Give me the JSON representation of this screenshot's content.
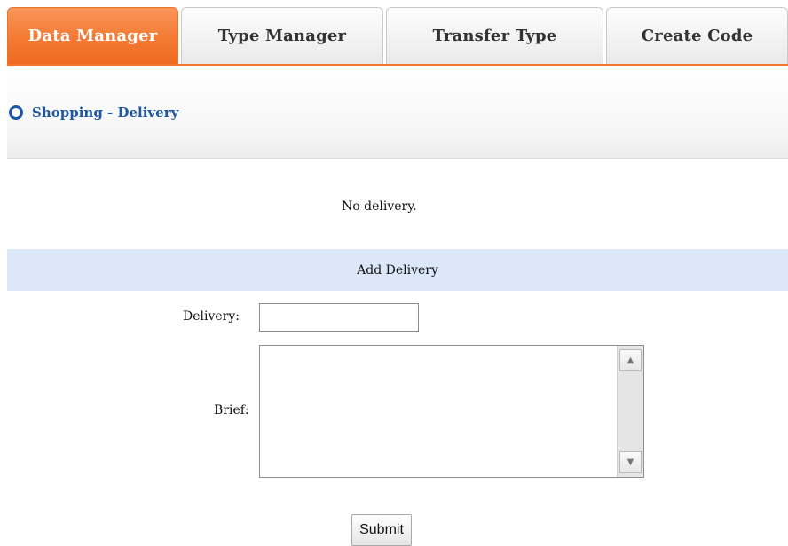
{
  "tabs": [
    {
      "label": "Data Manager",
      "active": true
    },
    {
      "label": "Type Manager",
      "active": false
    },
    {
      "label": "Transfer Type",
      "active": false
    },
    {
      "label": "Create Code",
      "active": false
    }
  ],
  "breadcrumb": {
    "icon": "circle-icon",
    "text": "Shopping - Delivery"
  },
  "message": "No delivery.",
  "form": {
    "header": "Add Delivery",
    "delivery_label": "Delivery:",
    "delivery_value": "",
    "brief_label": "Brief:",
    "brief_value": "",
    "submit_label": "Submit"
  },
  "colors": {
    "accent": "#f47a33",
    "link_blue": "#1f56a4",
    "section_header_bg": "#dce7fa"
  }
}
